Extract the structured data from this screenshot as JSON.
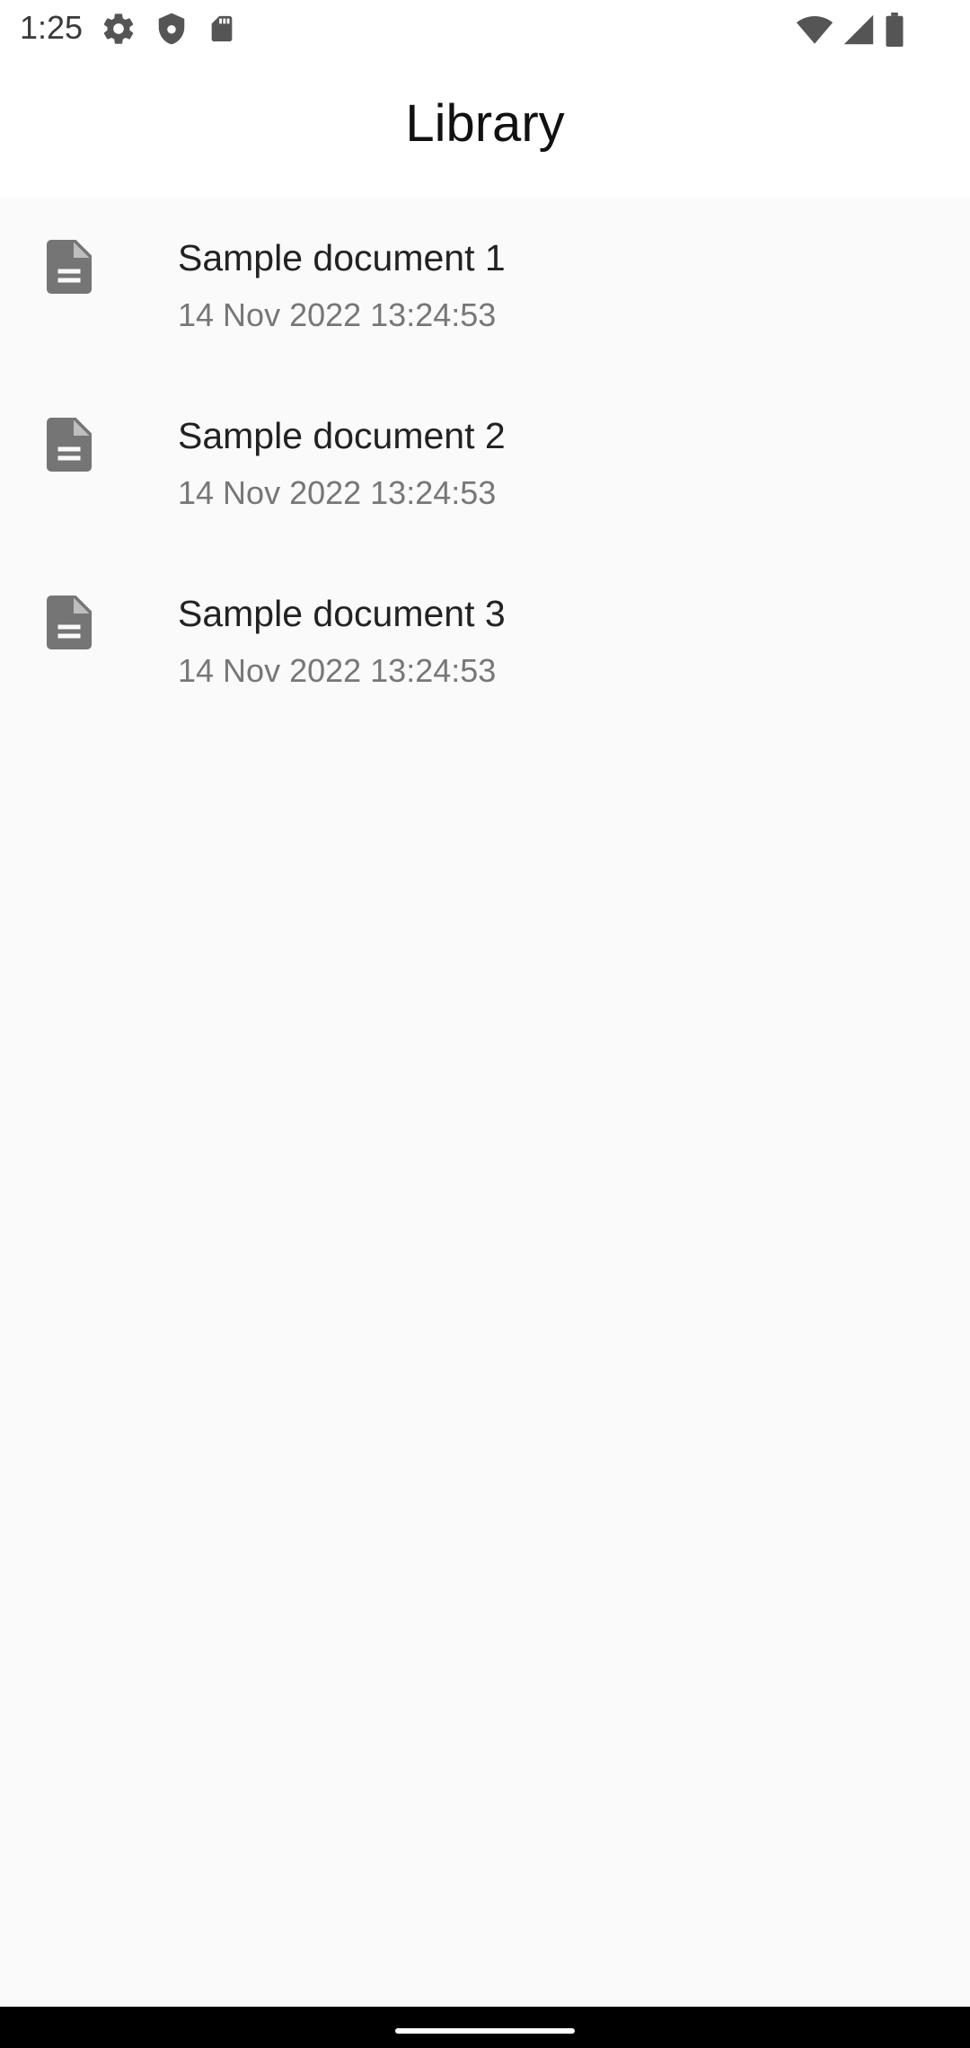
{
  "status_bar": {
    "time": "1:25",
    "icons_left": [
      "settings-icon",
      "shield-icon",
      "sd-card-icon"
    ],
    "icons_right": [
      "wifi-icon",
      "signal-icon",
      "battery-icon"
    ]
  },
  "app_bar": {
    "title": "Library"
  },
  "documents": [
    {
      "title": "Sample document 1",
      "date": "14 Nov 2022 13:24:53",
      "icon": "document-icon"
    },
    {
      "title": "Sample document 2",
      "date": "14 Nov 2022 13:24:53",
      "icon": "document-icon"
    },
    {
      "title": "Sample document 3",
      "date": "14 Nov 2022 13:24:53",
      "icon": "document-icon"
    }
  ],
  "colors": {
    "background": "#fafafa",
    "app_bar": "#ffffff",
    "icon_grey": "#757575",
    "nav_bar": "#000000"
  }
}
